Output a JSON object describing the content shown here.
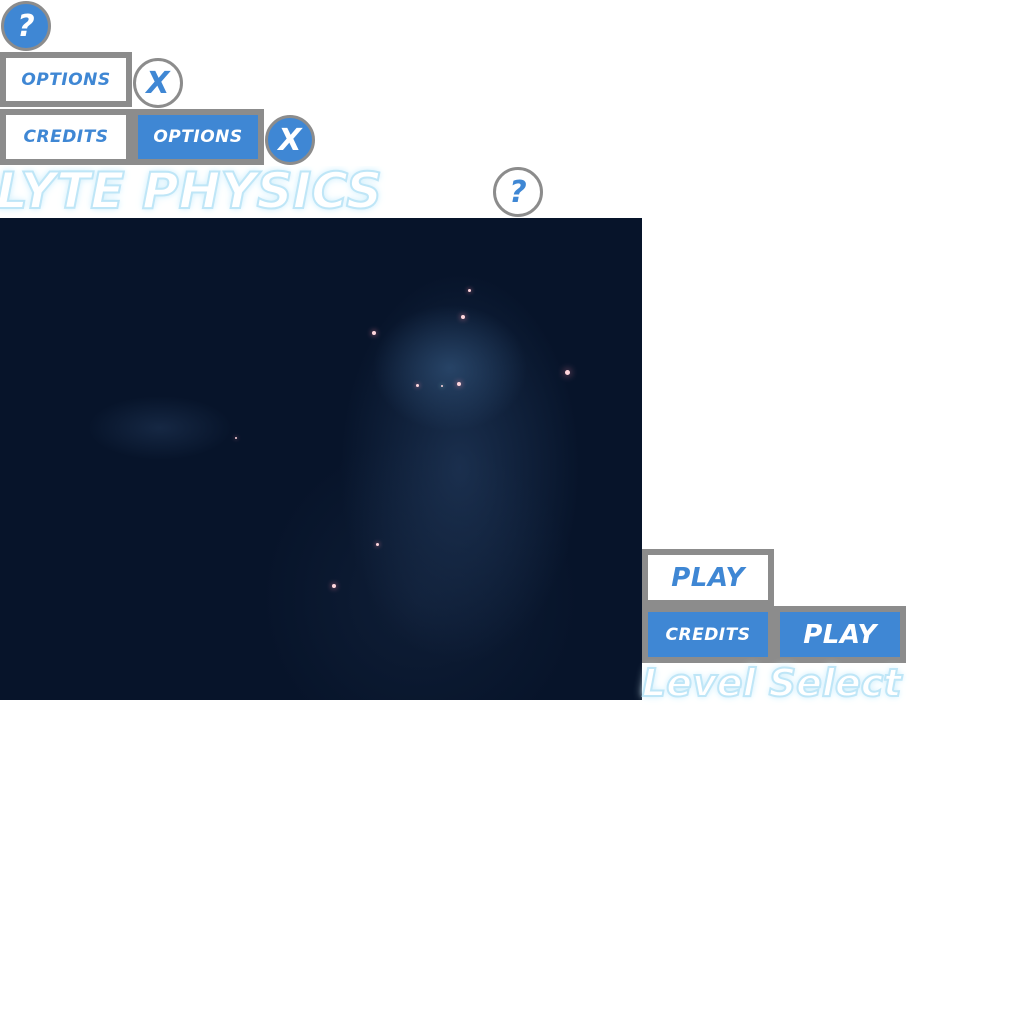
{
  "help_top": {
    "glyph": "?"
  },
  "menu_row1": {
    "options_label": "OPTIONS",
    "close_glyph": "X"
  },
  "menu_row2": {
    "credits_label": "CREDITS",
    "options_label": "OPTIONS",
    "close_glyph": "X"
  },
  "title": {
    "text": "LYTE PHYSICS",
    "help_glyph": "?"
  },
  "play_menu": {
    "play_label": "PLAY",
    "credits_label": "CREDITS",
    "play_label_2": "PLAY"
  },
  "level_select": {
    "text": "Level Select"
  },
  "colors": {
    "accent": "#3f87d4",
    "border": "#8c8c8c",
    "sky": "#07142a",
    "glow": "#bfe6f7"
  }
}
